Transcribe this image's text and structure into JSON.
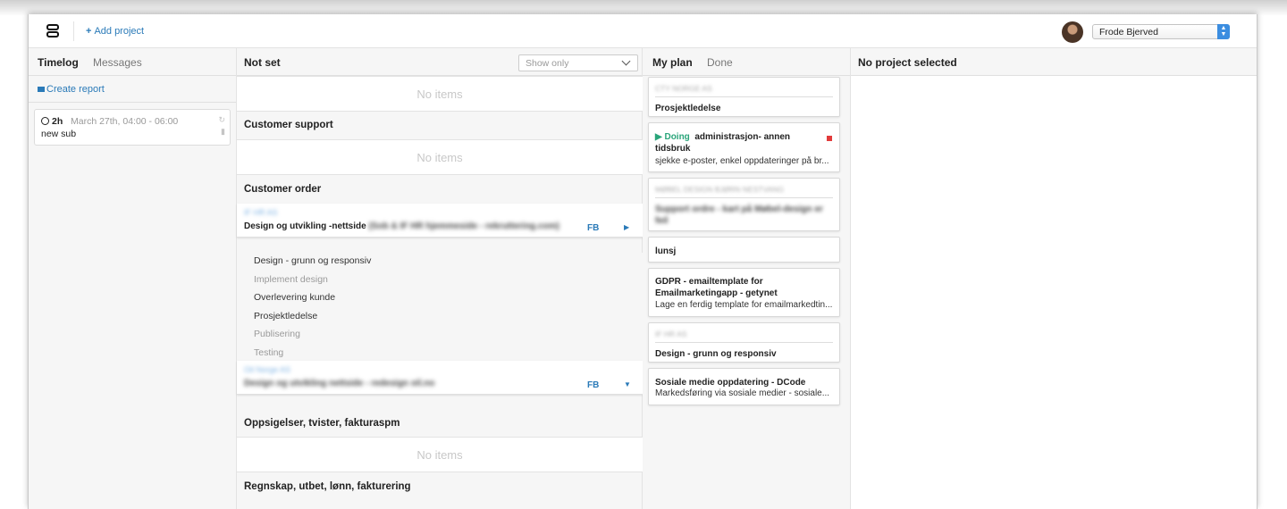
{
  "header": {
    "add_project": "Add project",
    "user": "Frode Bjerved"
  },
  "timelog": {
    "tabs": [
      "Timelog",
      "Messages"
    ],
    "create_report": "Create report",
    "entry": {
      "duration": "2h",
      "date": "March 27th, 04:00 - 06:00",
      "description": "new sub"
    }
  },
  "projects": {
    "title": "Not set",
    "filter_placeholder": "Show only",
    "empty_label": "No items",
    "sections": [
      "Customer support",
      "Customer order",
      "Oppsigelser, tvister, fakturaspm",
      "Regnskap, utbet, lønn, fakturering"
    ],
    "order1": {
      "client": "IF HR AS",
      "name": "Design og utvikling -nettside",
      "name_extra": "(Sob & IF HR hjemmeside - rekruttering.com)",
      "owner": "FB",
      "subtasks": [
        {
          "label": "Design - grunn og responsiv",
          "active": true
        },
        {
          "label": "Implement design",
          "active": false
        },
        {
          "label": "Overlevering kunde",
          "active": true
        },
        {
          "label": "Prosjektledelse",
          "active": true
        },
        {
          "label": "Publisering",
          "active": false
        },
        {
          "label": "Testing",
          "active": false
        }
      ]
    },
    "order2": {
      "client": "Oil Norge AS",
      "name": "Design og utvikling nettside - redesign oil.no",
      "owner": "FB"
    }
  },
  "plan": {
    "tabs": [
      "My plan",
      "Done"
    ],
    "cards": [
      {
        "client": "CTY NORGE AS",
        "title": "Prosjektledelse"
      },
      {
        "status": "Doing",
        "title1": "administrasjon- annen",
        "title2": "tidsbruk",
        "desc": "sjekke e-poster, enkel oppdateringer på br..."
      },
      {
        "client": "MØBEL DESIGN BJØRN NESTVANG",
        "title": "Support ordre - kart på Møbel-design er feil"
      },
      {
        "title": "lunsj"
      },
      {
        "title": "GDPR - emailtemplate for Emailmarketingapp - getynet",
        "desc": "Lage en ferdig template for emailmarkedtin..."
      },
      {
        "client": "IF HR AS",
        "title": "Design - grunn og responsiv"
      },
      {
        "title": "Sosiale medie oppdatering - DCode",
        "desc": "Markedsføring via sosiale medier - sosiale..."
      }
    ]
  },
  "detail": {
    "title": "No project selected"
  },
  "colors": {
    "accent": "#2a7ab8",
    "doing": "#2aa57a",
    "stop": "#e23b3b"
  }
}
